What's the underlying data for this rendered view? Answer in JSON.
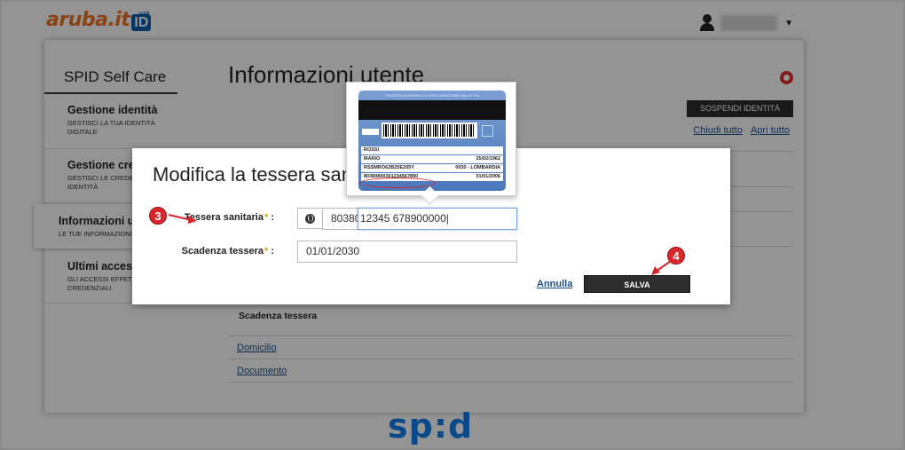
{
  "header": {
    "logo_text": "aruba.it",
    "logo_badge": "ID",
    "logo_badge_small": "spid"
  },
  "sidebar": {
    "title": "SPID Self Care",
    "items": [
      {
        "title": "Gestione identità",
        "subtitle": "GESTISCI LA TUA IDENTITÀ DIGITALE"
      },
      {
        "title": "Gestione cred",
        "subtitle": "GESTISCI LE CREDEN TUA IDENTITÀ"
      },
      {
        "title": "Informazioni ute",
        "subtitle": "LE TUE INFORMAZIONI P"
      },
      {
        "title": "Ultimi accessi",
        "subtitle": "GLI ACCESSI EFFETT TUE CREDENZIALI"
      }
    ]
  },
  "main": {
    "title": "Informazioni utente",
    "suspend_label": "SOSPENDI IDENTITÀ",
    "collapse_all": "Chiudi tutto",
    "expand_all": "Apri tutto",
    "background_field": "Scadenza tessera",
    "links": [
      "Domicilio",
      "Documento"
    ]
  },
  "modal": {
    "title": "Modifica la tessera sanitaria",
    "card_label": "Tessera sanitaria",
    "card_prefix": "80380",
    "card_value": "12345 678900000",
    "expiry_label": "Scadenza tessera",
    "expiry_value": "01/01/2030",
    "required_mark": "*",
    "colon": ":",
    "cancel_label": "Annulla",
    "save_label": "SALVA"
  },
  "card_tooltip": {
    "header": "TESSERA EUROPEA DI ASSICURAZIONE MALATTIA",
    "surname": "ROSSI",
    "name": "MARIO",
    "birth_date": "25/02/1962",
    "fiscal_code": "RSSMRO62B25E205Y",
    "region": "0030 - LOMBARDIA",
    "card_number": "80380800301234567890",
    "card_expiry": "01/01/2006"
  },
  "steps": [
    "3",
    "4"
  ],
  "footer": {
    "logo_text": "sp:d"
  },
  "colors": {
    "accent_orange": "#f27421",
    "brand_blue": "#0a5eb0",
    "button_dark": "#2d2d2d",
    "annotation_red": "#d8262b",
    "link_blue": "#1a4f8a"
  }
}
